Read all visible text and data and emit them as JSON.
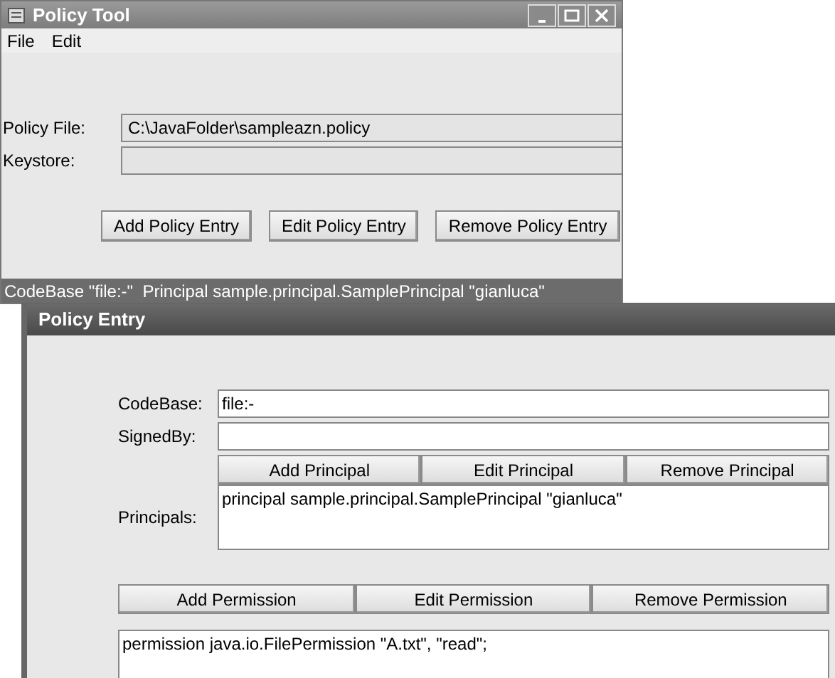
{
  "main_window": {
    "title": "Policy Tool",
    "menu": [
      "File",
      "Edit"
    ],
    "fields": [
      {
        "label": "Policy File:",
        "value": "C:\\JavaFolder\\sampleazn.policy"
      },
      {
        "label": "Keystore:"
      }
    ],
    "buttons": [
      "Add Policy Entry",
      "Edit Policy Entry",
      "Remove Policy Entry"
    ],
    "entries": [
      {
        "text": "CodeBase \"file:-\"  Principal sample.principal.SamplePrincipal \"gianluca\"",
        "selected": true
      }
    ]
  },
  "dialog": {
    "title": "Policy Entry",
    "codebase": {
      "label": "CodeBase:",
      "value": "file:-"
    },
    "signedby": {
      "label": "SignedBy:"
    },
    "principal_buttons": [
      "Add Principal",
      "Edit Principal",
      "Remove Principal"
    ],
    "principals": {
      "label": "Principals:",
      "items": [
        "principal sample.principal.SamplePrincipal \"gianluca\""
      ]
    },
    "permission_buttons": [
      "Add Permission",
      "Edit Permission",
      "Remove Permission"
    ],
    "permissions": [
      "permission java.io.FilePermission \"A.txt\", \"read\";"
    ]
  }
}
